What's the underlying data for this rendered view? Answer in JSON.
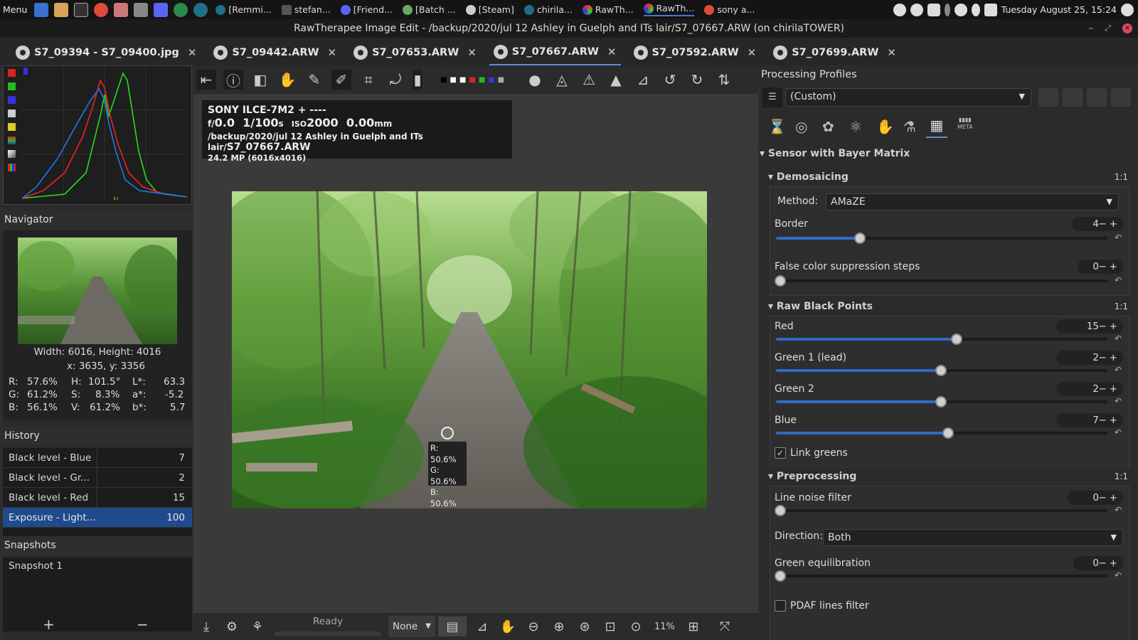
{
  "sysbar": {
    "menu": "Menu",
    "tasks": [
      "[Remmi...",
      "stefan...",
      "[Friend...",
      "[Batch ...",
      "[Steam]",
      "chirila...",
      "RawTh...",
      "RawTh...",
      "sony a..."
    ],
    "clock": "Tuesday August 25, 15:24"
  },
  "titlebar": {
    "title": "RawTherapee Image Edit - /backup/2020/jul 12 Ashley in Guelph and ITs lair/S7_07667.ARW (on chirilaTOWER)"
  },
  "tabs": [
    "S7_09394 - S7_09400.jpg",
    "S7_09442.ARW",
    "S7_07653.ARW",
    "S7_07667.ARW",
    "S7_07592.ARW",
    "S7_07699.ARW"
  ],
  "navigator": {
    "title": "Navigator",
    "size": "Width: 6016, Height: 4016",
    "coords": "x: 3635, y: 3356",
    "r": "R:",
    "r_val": "57.6%",
    "g": "G:",
    "g_val": "61.2%",
    "b": "B:",
    "b_val": "56.1%",
    "h": "H:",
    "h_val": "101.5°",
    "s": "S:",
    "s_val": "8.3%",
    "v": "V:",
    "v_val": "61.2%",
    "l": "L*:",
    "l_val": "63.3",
    "a": "a*:",
    "a_val": "-5.2",
    "bs": "b*:",
    "bs_val": "5.7"
  },
  "history": {
    "title": "History",
    "rows": [
      {
        "name": "Black level - Blue",
        "value": "7"
      },
      {
        "name": "Black level - Gr...",
        "value": "2"
      },
      {
        "name": "Black level - Red",
        "value": "15"
      },
      {
        "name": "Exposure - Light...",
        "value": "100"
      }
    ]
  },
  "snapshots": {
    "title": "Snapshots",
    "items": [
      "Snapshot 1"
    ],
    "add": "+",
    "remove": "−"
  },
  "exif": {
    "line1": "SONY ILCE-7M2 + ----",
    "f": "f/",
    "fnum": "0.0",
    "shutter": "1/100",
    "s": "s",
    "iso": "ISO",
    "isoval": "2000",
    "focal": "0.00",
    "mm": "mm",
    "path": "/backup/2020/jul 12 Ashley in Guelph and ITs lair/",
    "file": "S7_07667.ARW",
    "mp": "24.2 MP (6016x4016)"
  },
  "picker": {
    "r": "R: 50.6%",
    "g": "G: 50.6%",
    "b": "B: 50.6%"
  },
  "bottombar": {
    "status": "Ready",
    "none": "None",
    "zoom": "11%"
  },
  "right": {
    "profiles_title": "Processing Profiles",
    "profile_value": "(Custom)",
    "meta_tab": "META",
    "sensor_title": "Sensor with Bayer Matrix",
    "demosaicing": "Demosaicing",
    "ratio": "1:1",
    "method_label": "Method:",
    "method_value": "AMaZE",
    "border_label": "Border",
    "border_value": "4",
    "fcs_label": "False color suppression steps",
    "fcs_value": "0",
    "rbp_title": "Raw Black Points",
    "red_label": "Red",
    "red_value": "15",
    "g1_label": "Green 1 (lead)",
    "g1_value": "2",
    "g2_label": "Green 2",
    "g2_value": "2",
    "blue_label": "Blue",
    "blue_value": "7",
    "link_greens": "Link greens",
    "pre_title": "Preprocessing",
    "lnf_label": "Line noise filter",
    "lnf_value": "0",
    "dir_label": "Direction:",
    "dir_value": "Both",
    "geq_label": "Green equilibration",
    "geq_value": "0",
    "pdaf_label": "PDAF lines filter"
  },
  "colors": {
    "accent": "#2f6bc4",
    "selected": "#1f4a8c"
  }
}
